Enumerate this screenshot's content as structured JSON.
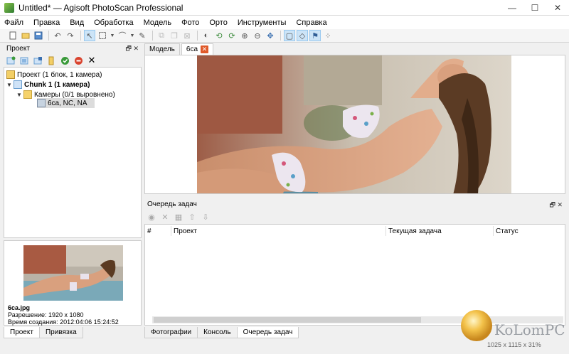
{
  "window": {
    "title": "Untitled* — Agisoft PhotoScan Professional",
    "controls": [
      "—",
      "☐",
      "✕"
    ]
  },
  "menu": [
    "Файл",
    "Правка",
    "Вид",
    "Обработка",
    "Модель",
    "Фото",
    "Орто",
    "Инструменты",
    "Справка"
  ],
  "project_panel": {
    "title": "Проект",
    "tree": {
      "root": "Проект (1 блок, 1 камера)",
      "chunk": "Chunk 1 (1 камера)",
      "cameras": "Камеры (0/1 выровнено)",
      "camera_item": "6ca, NC, NA"
    }
  },
  "preview": {
    "filename": "6ca.jpg",
    "resolution": "Разрешение: 1920 x 1080",
    "created": "Время создания: 2012:04:06 15:24:52"
  },
  "left_tabs": [
    "Проект",
    "Привязка"
  ],
  "doc_tabs": {
    "model": "Модель",
    "photo": "6ca"
  },
  "queue": {
    "title": "Очередь задач",
    "columns": {
      "num": "#",
      "project": "Проект",
      "current_task": "Текущая задача",
      "status": "Статус"
    }
  },
  "bottom_tabs": [
    "Фотографии",
    "Консоль",
    "Очередь задач"
  ],
  "watermark": {
    "text": "KoLomPC",
    "subtext": "1025 x 1115 x 31%"
  },
  "colors": {
    "selected_tab_close": "#e05a2a",
    "toolbar_selected": "#cce4f7"
  }
}
